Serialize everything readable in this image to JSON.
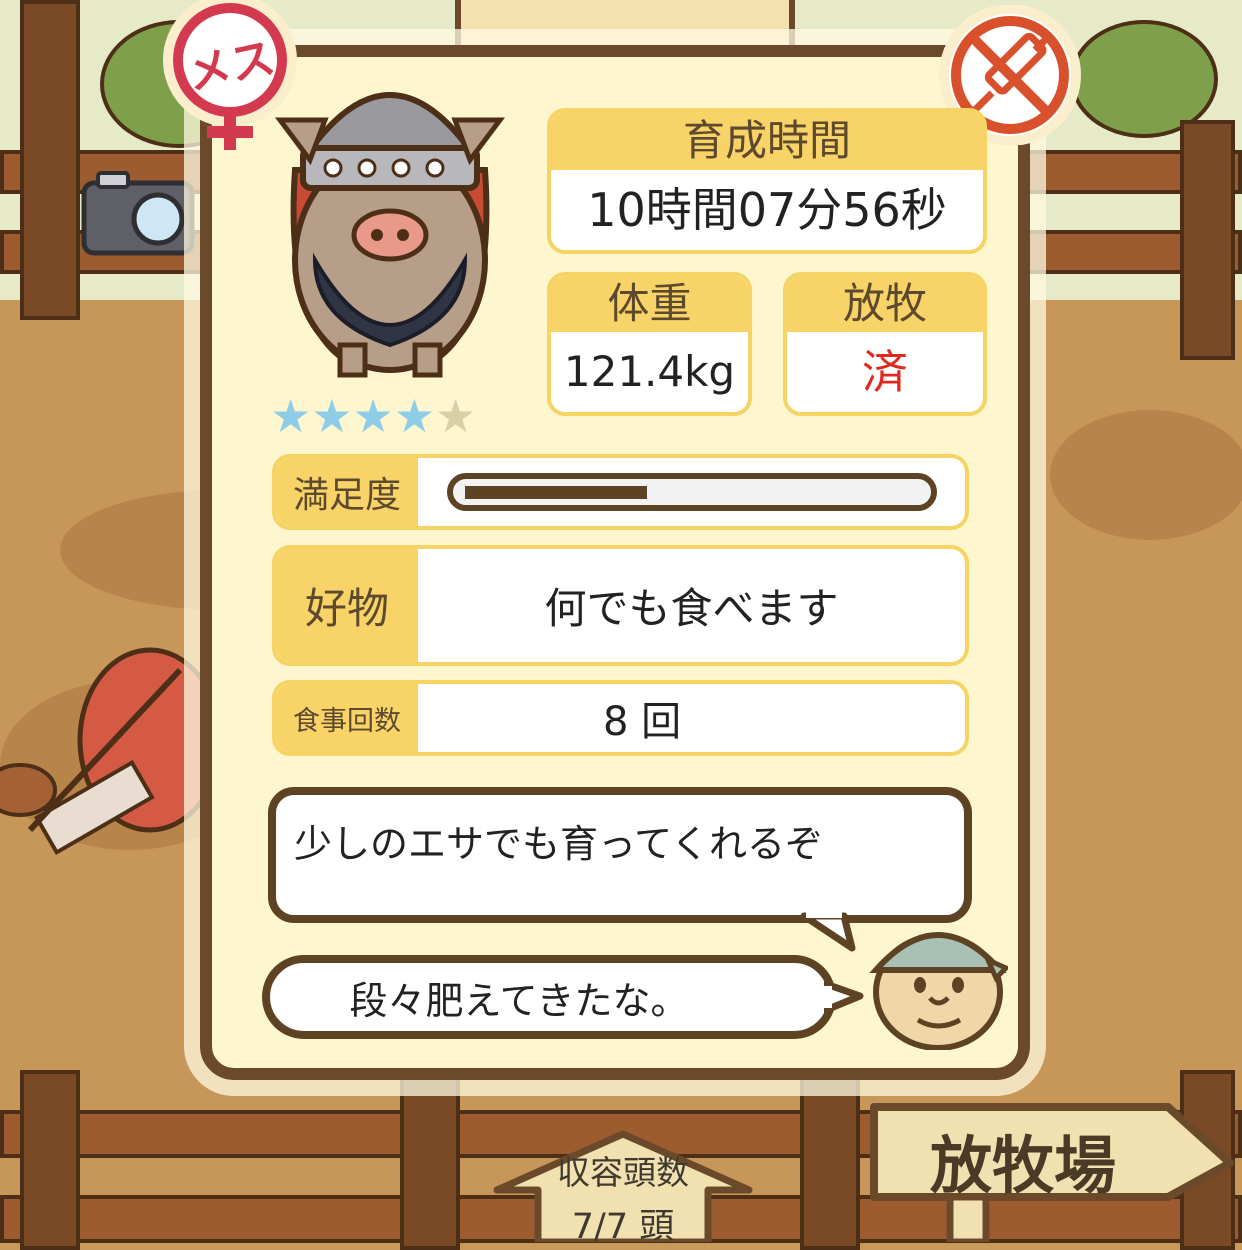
{
  "badges": {
    "gender_label": "メス",
    "gender_color": "#d43a4f",
    "vaccine_icon": "no-syringe-icon",
    "vaccine_color": "#d9512c"
  },
  "stats": {
    "growth_time_label": "育成時間",
    "growth_time_value": "10時間07分56秒",
    "weight_label": "体重",
    "weight_value": "121.4kg",
    "grazing_label": "放牧",
    "grazing_value": "済",
    "grazing_value_color": "#e0281e"
  },
  "rating": {
    "stars": 4,
    "max": 5,
    "filled_color": "#8ecde8",
    "empty_color": "#d9cfa6"
  },
  "satisfaction": {
    "label": "満足度",
    "level": 0.4
  },
  "favorite": {
    "label": "好物",
    "value": "何でも食べます"
  },
  "meals": {
    "label": "食事回数",
    "value": "8 回"
  },
  "speech": {
    "farmer_line": "少しのエサでも育ってくれるぞ",
    "pig_line": "段々肥えてきたな。"
  },
  "bottom": {
    "capacity_label": "収容頭数",
    "capacity_value": "7/7 頭",
    "pasture_sign": "放牧場"
  }
}
